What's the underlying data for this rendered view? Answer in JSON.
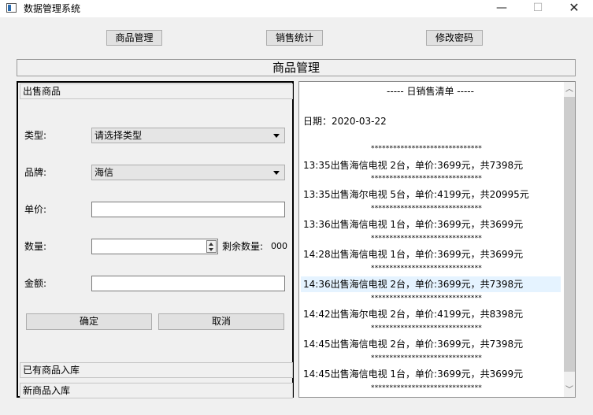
{
  "window": {
    "title": "数据管理系统",
    "minimize": "—",
    "maximize": "☐",
    "close": "✕"
  },
  "nav": {
    "goods_label": "商品管理",
    "sales_label": "销售统计",
    "password_label": "修改密码"
  },
  "page_header": "商品管理",
  "sell_form": {
    "section_title": "出售商品",
    "type_label": "类型:",
    "type_value": "请选择类型",
    "brand_label": "品牌:",
    "brand_value": "海信",
    "price_label": "单价:",
    "price_value": "",
    "quantity_label": "数量:",
    "quantity_value": "",
    "remaining_label": "剩余数量:",
    "remaining_value": "000",
    "amount_label": "金额:",
    "amount_value": "",
    "confirm_label": "确定",
    "cancel_label": "取消"
  },
  "sections": {
    "existing_label": "已有商品入库",
    "new_label": "新商品入库"
  },
  "receipt": {
    "title": "----- 日销售清单 -----",
    "date_line": "日期：2020-03-22",
    "separator": "******************************",
    "entries": [
      "13:35出售海信电视 2台，单价:3699元，共7398元",
      "13:35出售海尔电视 5台，单价:4199元，共20995元",
      "13:36出售海信电视 1台，单价:3699元，共3699元",
      "14:28出售海信电视 1台，单价:3699元，共3699元",
      "14:36出售海信电视 2台，单价:3699元，共7398元",
      "14:42出售海尔电视 2台，单价:4199元，共8398元",
      "14:45出售海信电视 2台，单价:3699元，共7398元",
      "14:45出售海信电视 1台，单价:3699元，共3699元"
    ],
    "highlighted_index": 4
  },
  "colors": {
    "highlight": "#e5f3ff",
    "panel_bg": "#f0f0f0",
    "button_bg": "#e1e1e1"
  }
}
